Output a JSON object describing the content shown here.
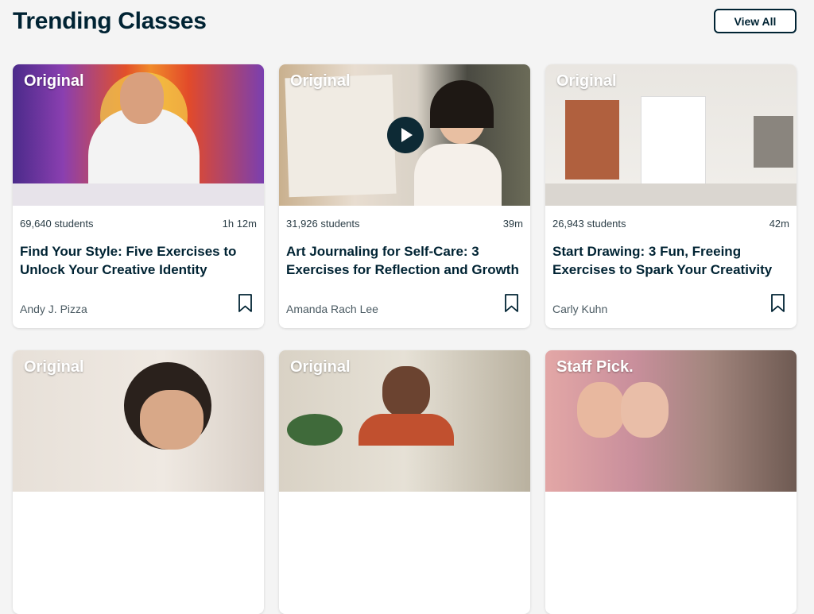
{
  "header": {
    "title": "Trending Classes",
    "view_all": "View All"
  },
  "cards": [
    {
      "badge": "Original",
      "students": "69,640 students",
      "duration": "1h 12m",
      "title": "Find Your Style: Five Exercises to Unlock Your Creative Identity",
      "author": "Andy J. Pizza"
    },
    {
      "badge": "Original",
      "students": "31,926 students",
      "duration": "39m",
      "title": "Art Journaling for Self-Care: 3 Exercises for Reflection and Growth",
      "author": "Amanda Rach Lee"
    },
    {
      "badge": "Original",
      "students": "26,943 students",
      "duration": "42m",
      "title": "Start Drawing: 3 Fun, Freeing Exercises to Spark Your Creativity",
      "author": "Carly Kuhn"
    },
    {
      "badge": "Original"
    },
    {
      "badge": "Original"
    },
    {
      "badge": "Staff Pick."
    }
  ],
  "colors": {
    "text": "#002333",
    "accent_green": "#00ff84",
    "background": "#f4f4f4"
  },
  "icons": {
    "bookmark": "bookmark-icon",
    "play": "play-icon"
  }
}
